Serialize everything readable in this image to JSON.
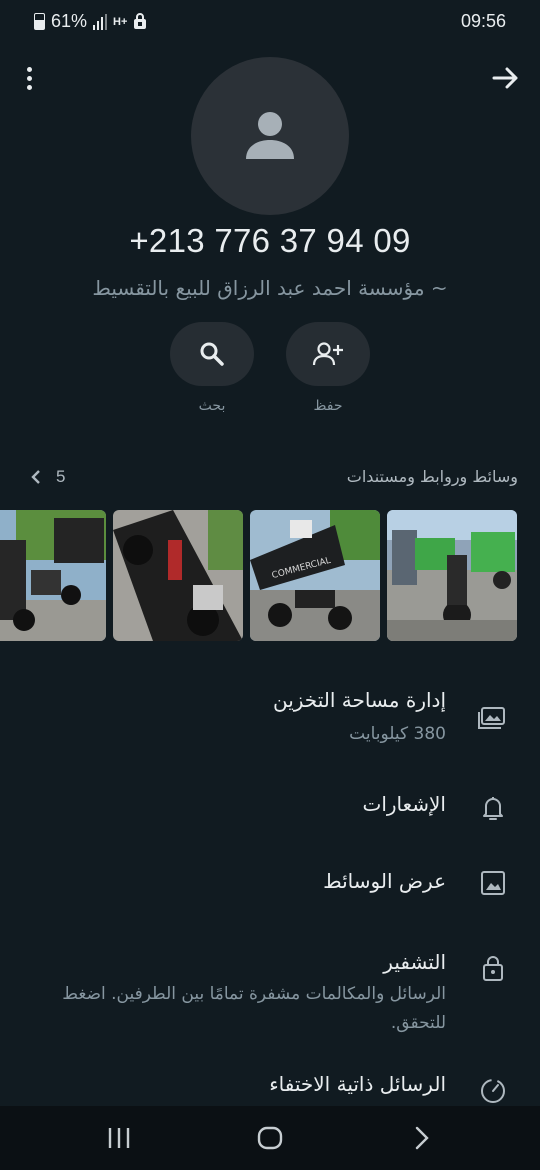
{
  "status_bar": {
    "battery": "61%",
    "network": "H+",
    "time": "09:56"
  },
  "contact": {
    "phone": "+213 776 37 94 09",
    "push_name": "~ مؤسسة احمد عبد الرزاق للبيع بالتقسيط"
  },
  "actions": {
    "save_label": "حفظ",
    "search_label": "بحث"
  },
  "media": {
    "title": "وسائط وروابط ومستندات",
    "count": "5"
  },
  "settings": {
    "storage_title": "إدارة مساحة التخزين",
    "storage_size": "380 كيلوبايت",
    "notifications_title": "الإشعارات",
    "media_visibility_title": "عرض الوسائط",
    "encryption_title": "التشفير",
    "encryption_line1": "الرسائل والمكالمات مشفرة تمامًا بين الطرفين. اضغط",
    "encryption_line2": "للتحقق.",
    "disappearing_title": "الرسائل ذاتية الاختفاء"
  },
  "icons": [
    "menu-icon",
    "forward-arrow-icon",
    "person-icon",
    "search-icon",
    "add-person-icon",
    "chevron-left-icon",
    "storage-icon",
    "bell-icon",
    "image-icon",
    "lock-icon",
    "timer-icon",
    "recents-icon",
    "home-icon",
    "back-icon"
  ],
  "colors": {
    "background": "#111b21",
    "primary_text": "#e9edef",
    "secondary_text": "#8696a0",
    "button_bg": "#262d33"
  }
}
